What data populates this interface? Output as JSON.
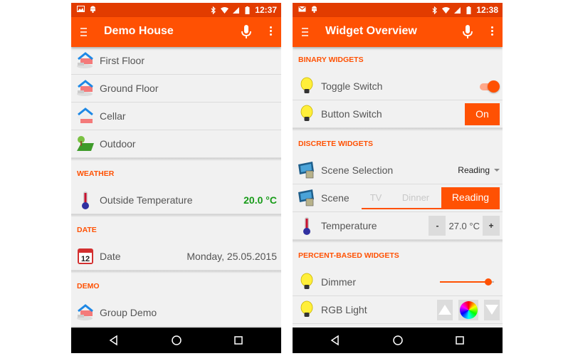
{
  "left_screen": {
    "status_bar": {
      "time": "12:37",
      "left_icons": [
        "gallery-icon",
        "android-debug-icon"
      ],
      "right_icons": [
        "bluetooth-icon",
        "wifi-icon",
        "signal-icon",
        "battery-icon"
      ]
    },
    "app_bar": {
      "title": "Demo House",
      "menu_icon": "hamburger-icon",
      "mic_icon": "mic-icon",
      "more_icon": "more-vert-icon"
    },
    "items": [
      {
        "label": "First Floor",
        "icon": "house-floor-icon"
      },
      {
        "label": "Ground Floor",
        "icon": "house-floor-icon"
      },
      {
        "label": "Cellar",
        "icon": "house-cellar-icon"
      },
      {
        "label": "Outdoor",
        "icon": "garden-icon"
      }
    ],
    "sections": [
      {
        "header": "WEATHER",
        "items": [
          {
            "label": "Outside Temperature",
            "value": "20.0 °C",
            "value_color": "#179b18",
            "icon": "thermometer-icon"
          }
        ]
      },
      {
        "header": "DATE",
        "items": [
          {
            "label": "Date",
            "value": "Monday, 25.05.2015",
            "icon": "calendar-icon",
            "icon_text": "12"
          }
        ]
      },
      {
        "header": "DEMO",
        "items": [
          {
            "label": "Group Demo",
            "icon": "house-floor-icon"
          }
        ]
      }
    ],
    "nav_bar": {
      "back": "back-icon",
      "home": "home-icon",
      "recents": "recents-icon"
    }
  },
  "right_screen": {
    "status_bar": {
      "time": "12:38",
      "left_icons": [
        "gmail-icon",
        "android-debug-icon"
      ],
      "right_icons": [
        "bluetooth-icon",
        "wifi-icon",
        "signal-icon",
        "battery-icon"
      ]
    },
    "app_bar": {
      "title": "Widget Overview",
      "menu_icon": "hamburger-icon",
      "mic_icon": "mic-icon",
      "more_icon": "more-vert-icon"
    },
    "binary": {
      "header": "BINARY WIDGETS",
      "toggle": {
        "label": "Toggle Switch",
        "state": "on"
      },
      "button": {
        "label": "Button Switch",
        "button_label": "On"
      }
    },
    "discrete": {
      "header": "DISCRETE WIDGETS",
      "scene_selection": {
        "label": "Scene Selection",
        "selected": "Reading"
      },
      "scene": {
        "label": "Scene",
        "options": [
          "TV",
          "Dinner",
          "Reading"
        ],
        "selected": "Reading"
      },
      "temperature": {
        "label": "Temperature",
        "value": "27.0 °C",
        "minus": "-",
        "plus": "+"
      }
    },
    "percent": {
      "header": "PERCENT-BASED WIDGETS",
      "dimmer": {
        "label": "Dimmer",
        "percent": 90
      },
      "rgb": {
        "label": "RGB Light"
      }
    },
    "nav_bar": {
      "back": "back-icon",
      "home": "home-icon",
      "recents": "recents-icon"
    }
  },
  "colors": {
    "accent": "#ff5103",
    "status_bar": "#e23c00",
    "background": "#f1f1f1",
    "value_green": "#179b18"
  }
}
